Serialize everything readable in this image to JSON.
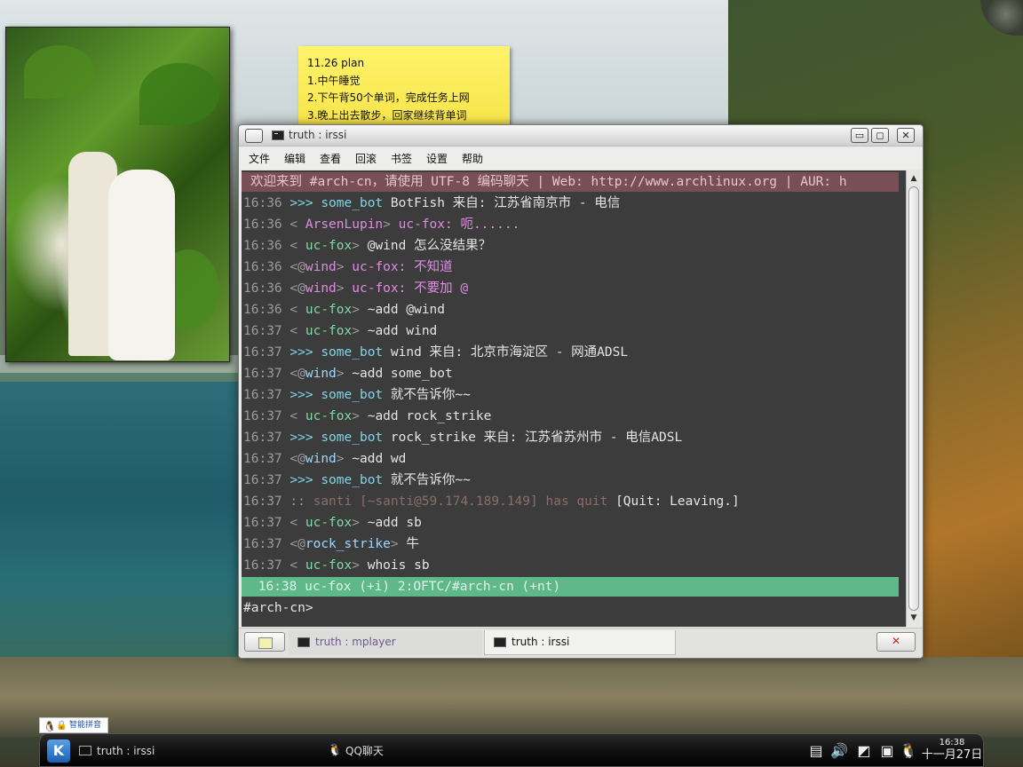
{
  "note": {
    "lines": [
      "11.26 plan",
      "1.中午睡觉",
      "2.下午背50个单词，完成任务上网",
      "3.晚上出去散步，回家继续背单词"
    ]
  },
  "window": {
    "title": "truth : irssi",
    "buttons": {
      "minimize": "▭",
      "maximize": "◻",
      "close": "✕"
    },
    "menu": [
      "文件",
      "编辑",
      "查看",
      "回滚",
      "书签",
      "设置",
      "帮助"
    ]
  },
  "terminal": {
    "topic": "欢迎来到 #arch-cn，请使用 UTF-8 编码聊天 | Web: http://www.archlinux.org | AUR: h",
    "lines": [
      {
        "time": "16:36",
        "prefix": " >>> ",
        "nick": "some_bot",
        "nickClass": "bot",
        "sep": " ",
        "msg": "BotFish 来自: 江苏省南京市 - 电信",
        "msgClass": ""
      },
      {
        "time": "16:36",
        "prefix": " < ",
        "nick": "ArsenLupin",
        "nickClass": "nick2",
        "sep": "> ",
        "msg": "uc-fox: 呃......",
        "msgClass": "pink"
      },
      {
        "time": "16:36",
        "prefix": " < ",
        "nick": "uc-fox",
        "nickClass": "nickg",
        "sep": "> ",
        "msg": "@wind 怎么没结果？",
        "msgClass": ""
      },
      {
        "time": "16:36",
        "prefix": " <@",
        "nick": "wind",
        "nickClass": "nick2",
        "sep": "> ",
        "msg": "uc-fox: 不知道",
        "msgClass": "pink"
      },
      {
        "time": "16:36",
        "prefix": " <@",
        "nick": "wind",
        "nickClass": "nick2",
        "sep": "> ",
        "msg": "uc-fox: 不要加 @",
        "msgClass": "pink"
      },
      {
        "time": "16:36",
        "prefix": " < ",
        "nick": "uc-fox",
        "nickClass": "nickg",
        "sep": "> ",
        "msg": "~add @wind",
        "msgClass": ""
      },
      {
        "time": "16:37",
        "prefix": " < ",
        "nick": "uc-fox",
        "nickClass": "nickg",
        "sep": "> ",
        "msg": "~add wind",
        "msgClass": ""
      },
      {
        "time": "16:37",
        "prefix": " >>> ",
        "nick": "some_bot",
        "nickClass": "bot",
        "sep": " ",
        "msg": "wind 来自: 北京市海淀区 - 网通ADSL",
        "msgClass": ""
      },
      {
        "time": "16:37",
        "prefix": " <@",
        "nick": "wind",
        "nickClass": "nicka",
        "sep": "> ",
        "msg": "~add some_bot",
        "msgClass": ""
      },
      {
        "time": "16:37",
        "prefix": " >>> ",
        "nick": "some_bot",
        "nickClass": "bot",
        "sep": " ",
        "msg": "就不告诉你~~",
        "msgClass": ""
      },
      {
        "time": "16:37",
        "prefix": " < ",
        "nick": "uc-fox",
        "nickClass": "nickg",
        "sep": "> ",
        "msg": "~add rock_strike",
        "msgClass": ""
      },
      {
        "time": "16:37",
        "prefix": " >>> ",
        "nick": "some_bot",
        "nickClass": "bot",
        "sep": " ",
        "msg": "rock_strike 来自: 江苏省苏州市 - 电信ADSL",
        "msgClass": ""
      },
      {
        "time": "16:37",
        "prefix": " <@",
        "nick": "wind",
        "nickClass": "nicka",
        "sep": "> ",
        "msg": "~add wd",
        "msgClass": ""
      },
      {
        "time": "16:37",
        "prefix": " >>> ",
        "nick": "some_bot",
        "nickClass": "bot",
        "sep": " ",
        "msg": "就不告诉你~~",
        "msgClass": ""
      },
      {
        "time": "16:37",
        "prefix": " ::",
        "nick": " santi [~santi@59.174.189.149] has quit ",
        "nickClass": "quit",
        "sep": "",
        "msg": "[Quit: Leaving.]",
        "msgClass": ""
      },
      {
        "time": "16:37",
        "prefix": " < ",
        "nick": "uc-fox",
        "nickClass": "nickg",
        "sep": "> ",
        "msg": "~add sb",
        "msgClass": ""
      },
      {
        "time": "16:37",
        "prefix": " <@",
        "nick": "rock_strike",
        "nickClass": "nicka",
        "sep": "> ",
        "msg": "牛",
        "msgClass": ""
      },
      {
        "time": "16:37",
        "prefix": " < ",
        "nick": "uc-fox",
        "nickClass": "nickg",
        "sep": "> ",
        "msg": "whois sb",
        "msgClass": ""
      }
    ],
    "status": " 16:38 uc-fox (+i) 2:OFTC/#arch-cn (+nt)",
    "prompt": "#arch-cn>"
  },
  "tabs": [
    {
      "label": "truth : mplayer",
      "active": false
    },
    {
      "label": "truth : irssi",
      "active": true
    }
  ],
  "ime": {
    "label": "智能拼音"
  },
  "panel": {
    "kmenu": "K",
    "tasks": [
      "truth : irssi",
      "QQ聊天"
    ],
    "clock_time": "16:38",
    "clock_date": "十一月27日"
  }
}
